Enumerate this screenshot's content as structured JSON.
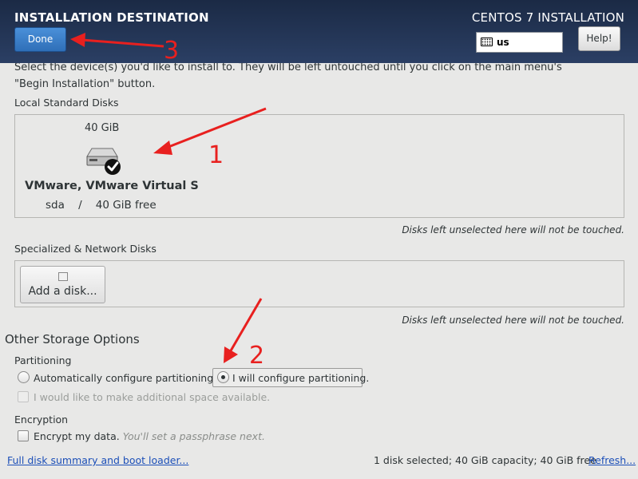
{
  "header": {
    "title": "INSTALLATION DESTINATION",
    "product": "CENTOS 7 INSTALLATION",
    "done_label": "Done",
    "keyboard_layout": "us",
    "help_label": "Help!"
  },
  "intro": {
    "line1": "Select the device(s) you'd like to install to. They will be left untouched until you click on the main menu's",
    "line2": "\"Begin Installation\" button."
  },
  "local_disks": {
    "label": "Local Standard Disks",
    "disk": {
      "size": "40 GiB",
      "name": "VMware, VMware Virtual S",
      "device": "sda",
      "separator": "/",
      "free": "40 GiB free",
      "selected": true
    },
    "note": "Disks left unselected here will not be touched."
  },
  "network_disks": {
    "label": "Specialized & Network Disks",
    "add_label": "Add a disk...",
    "note": "Disks left unselected here will not be touched."
  },
  "other_storage": {
    "heading": "Other Storage Options",
    "partitioning_label": "Partitioning",
    "auto_label": "Automatically configure partitioning.",
    "manual_label": "I will configure partitioning.",
    "selected": "manual",
    "extra_space_label": "I would like to make additional space available.",
    "encryption_label": "Encryption",
    "encrypt_label": "Encrypt my data.",
    "encrypt_hint": "You'll set a passphrase next."
  },
  "footer": {
    "summary_link": "Full disk summary and boot loader...",
    "status": "1 disk selected; 40 GiB capacity; 40 GiB free",
    "refresh_link": "Refresh..."
  },
  "annotations": {
    "label_1": "1",
    "label_2": "2",
    "label_3": "3",
    "color": "#e8201f"
  }
}
